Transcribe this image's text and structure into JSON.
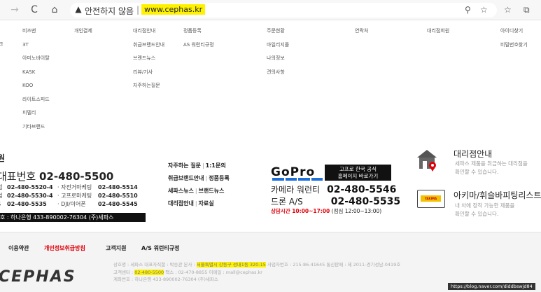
{
  "browser": {
    "security_text": "안전하지 않음",
    "separator": "|",
    "url": "www.cephas.kr",
    "back_icon": "→",
    "reload_icon": "C",
    "home_icon": "⌂"
  },
  "menu": {
    "col0": [
      "크"
    ],
    "col1": [
      "비즈맨",
      "3T",
      "아미노바이탈",
      "KASK",
      "KOO",
      "라이트스피드",
      "피델리",
      "기타브랜드"
    ],
    "col2": [
      "개인결제"
    ],
    "col3": [
      "대리점안내",
      "취급브랜드안내",
      "브랜드뉴스",
      "리뷰/기사",
      "자주하는질문"
    ],
    "col4": [
      "정품등록",
      "AS 워런티규정"
    ],
    "col5": [
      "주문현황",
      "마일리지몰",
      "나의정보",
      "견의사항"
    ],
    "col6": [
      "연락처"
    ],
    "col7": [
      "대리점회원"
    ],
    "col8": [
      "아이디찾기",
      "비밀번호찾기"
    ]
  },
  "support": {
    "title": "원",
    "main_label": "대표번호",
    "main_number": "02-480-5500",
    "rows": [
      {
        "label": "업",
        "num": "02-480-5520-4",
        "label2": "· 자전거마케팅",
        "num2": "02-480-5514"
      },
      {
        "label": "업",
        "num": "02-480-5530-4",
        "label2": "· 고프로마케팅",
        "num2": "02-480-5510"
      },
      {
        "label": "S",
        "num": "02-480-5535",
        "label2": "· DJI/이어폰",
        "num2": "02-480-5545"
      }
    ],
    "account": "호 : 하나은행  433-890002-76304 (주)세파스"
  },
  "links": {
    "row1": [
      "자주하는 질문",
      "1:1문의"
    ],
    "row2": [
      "취급브랜드안내",
      "정품등록"
    ],
    "row3": [
      "세파스뉴스",
      "브랜드뉴스"
    ],
    "row4": [
      "대리점안내",
      "자료실"
    ],
    "sep": "|"
  },
  "gopro": {
    "logo": "GoPro",
    "box_line1": "고프로 한국 공식",
    "box_line2": "홈페이지 바로가기",
    "camera_label": "카메라 워런티",
    "camera_number": "02-480-5546",
    "drone_label": "드론 A/S",
    "drone_number": "02-480-5535",
    "hours_label": "상담시간 10:00~17:00",
    "lunch": "(점심 12:00~13:00)"
  },
  "agent": {
    "title": "대리점안내",
    "desc1": "세파스 제품을 취급하는 대리점을",
    "desc2": "확인할 수 있습니다."
  },
  "badge": {
    "title": "아키마/휘슬바피팅리스트",
    "desc1": "내 차에 장착 가능한 제품을",
    "desc2": "확인할 수 있습니다.",
    "icon_text": "YAKIMA"
  },
  "footer_nav": [
    "이용약관",
    "개인정보취급방침",
    "고객지원",
    "A/S 워런티규정"
  ],
  "footer": {
    "logo": "CEPHAS",
    "line1a": "상호명 : 세파스   대표자직함 : 박승관   본사 : ",
    "line1_addr": "서울특별시 강동구 성내1동 320-15",
    "line1b": "   사업자번호 : 215-86-41645 통신판매 : 제 2011-경기성남-0419호",
    "line2a": "고객센터 : ",
    "line2_phone": "02-480-5500",
    "line2b": "   팩스 : 02-470-8855   이메일 : mall@cephas.kr",
    "line3": "계좌번호 : 하나은행 433-890002-76304 (주)세파스"
  },
  "source_tag": "https://blog.naver.com/diddbswjd84",
  "colors": {
    "highlight": "#fff200",
    "accent_red": "#e0000a",
    "gopro_blue": "#1e6fd9"
  }
}
